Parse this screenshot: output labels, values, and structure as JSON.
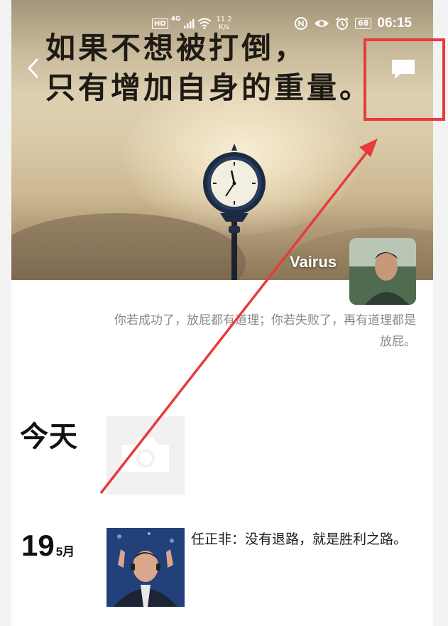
{
  "status_bar": {
    "hd": "HD",
    "network": "4G",
    "speed_value": "11.2",
    "speed_unit": "K/s",
    "battery": "68",
    "time": "06:15"
  },
  "cover": {
    "quote": "如果不想被打倒，\n只有增加自身的重量。"
  },
  "profile": {
    "author_name": "Vairus",
    "signature": "你若成功了，放屁都有道理；你若失败了，再有道理都是放屁。"
  },
  "timeline": {
    "today_label": "今天",
    "post_day": "19",
    "post_month": "5月",
    "post_text": "任正非：没有退路，就是胜利之路。"
  },
  "icons": {
    "back": "back-chevron-icon",
    "message": "message-bubble-icon",
    "camera": "camera-icon"
  },
  "colors": {
    "annotation_red": "#e83a3a",
    "text_primary": "#111111",
    "text_secondary": "#8a8a8a"
  }
}
